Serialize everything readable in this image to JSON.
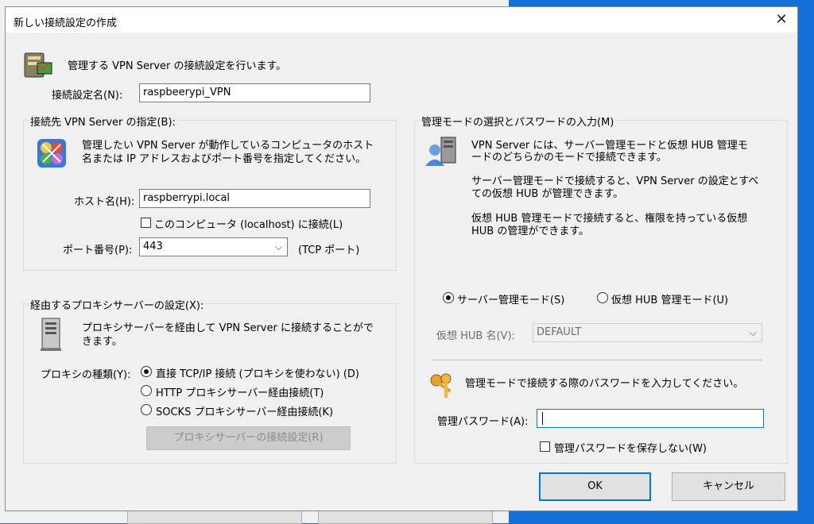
{
  "dialog": {
    "title": "新しい接続設定の作成",
    "intro": "管理する VPN Server の接続設定を行います。",
    "setting_name_label": "接続設定名(N):",
    "setting_name_value": "raspbeerypi_VPN"
  },
  "server_group": {
    "title": "接続先 VPN Server の指定(B):",
    "desc_line1": "管理したい VPN Server が動作しているコンピュータのホスト",
    "desc_line2": "名または IP アドレスおよびポート番号を指定してください。",
    "host_label": "ホスト名(H):",
    "host_value": "raspberrypi.local",
    "localhost_check_label": "このコンピュータ (localhost) に接続(L)",
    "port_label": "ポート番号(P):",
    "port_value": "443",
    "port_suffix": "(TCP ポート)"
  },
  "proxy_group": {
    "title": "経由するプロキシサーバーの設定(X):",
    "desc_line1": "プロキシサーバーを経由して VPN Server に接続することがで",
    "desc_line2": "きます。",
    "type_label": "プロキシの種類(Y):",
    "option_direct": "直接 TCP/IP 接続 (プロキシを使わない) (D)",
    "option_http": "HTTP プロキシサーバー経由接続(T)",
    "option_socks": "SOCKS プロキシサーバー経由接続(K)",
    "settings_button": "プロキシサーバーの接続設定(R)"
  },
  "admin_group": {
    "title": "管理モードの選択とパスワードの入力(M)",
    "desc1_line1": "VPN Server には、サーバー管理モードと仮想 HUB 管理モ",
    "desc1_line2": "ードのどちらかのモードで接続できます。",
    "desc2_line1": "サーバー管理モードで接続すると、VPN Server の設定とすべ",
    "desc2_line2": "ての仮想 HUB が管理できます。",
    "desc3_line1": "仮想 HUB 管理モードで接続すると、権限を持っている仮想",
    "desc3_line2": "HUB の管理ができます。",
    "mode_server": "サーバー管理モード(S)",
    "mode_hub": "仮想 HUB 管理モード(U)",
    "hub_name_label": "仮想 HUB 名(V):",
    "hub_name_value": "DEFAULT",
    "password_prompt": "管理モードで接続する際のパスワードを入力してください。",
    "password_label": "管理パスワード(A):",
    "password_value": "",
    "no_save_label": "管理パスワードを保存しない(W)"
  },
  "buttons": {
    "ok": "OK",
    "cancel": "キャンセル"
  }
}
